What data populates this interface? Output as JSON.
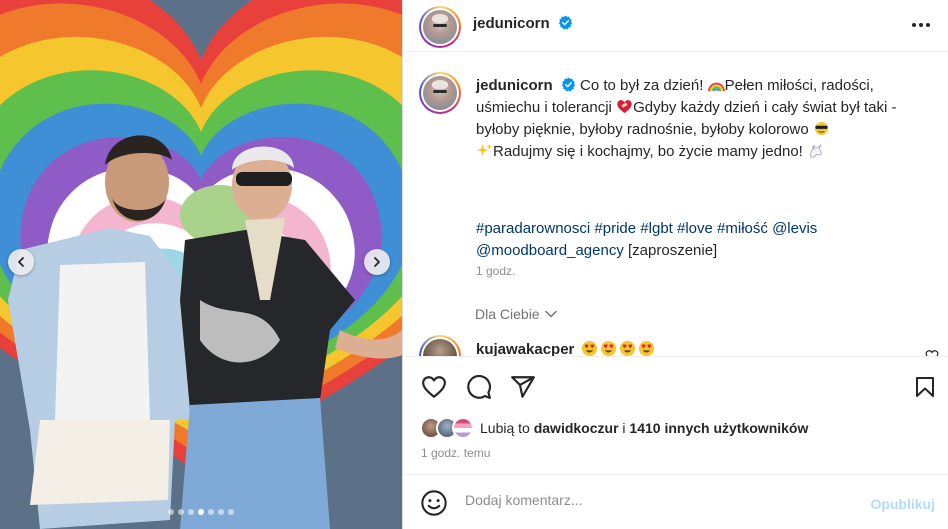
{
  "colors": {
    "link": "#00376b",
    "muted": "#8e8e8e",
    "verified": "#0095f6",
    "publish_disabled": "#b3dbff"
  },
  "photo": {
    "carousel_total": 7,
    "carousel_active": 3
  },
  "header": {
    "username": "jedunicorn",
    "verified_icon": "verified-badge-icon",
    "more_icon": "more-horizontal-icon"
  },
  "caption": {
    "username": "jedunicorn",
    "text_1": "Co to był za dzień!",
    "emoji_1": "rainbow",
    "text_2": "Pełen miłości, radości, uśmiechu i tolerancji",
    "emoji_2": "heart-with-bandage",
    "text_3": "Gdyby każdy dzień i cały świat był taki - byłoby pięknie, byłoby radnośnie, byłoby kolorowo",
    "emoji_3": "sunglasses-face",
    "emoji_4": "sparkles",
    "text_4": "Radujmy się i kochajmy, bo życie mamy jedno!",
    "emoji_5": "unicorn",
    "tags": [
      "#paradarownosci",
      "#pride",
      "#lgbt",
      "#love",
      "#miłość",
      "@levis",
      "@moodboard_agency"
    ],
    "tag_suffix": "[zaproszenie]",
    "time": "1 godz."
  },
  "for_you": "Dla Ciebie",
  "comment": {
    "username": "kujawakacper",
    "emojis": [
      "heart-eyes",
      "heart-eyes",
      "heart-eyes",
      "heart-eyes"
    ]
  },
  "actions": {
    "like_icon": "heart-icon",
    "comment_icon": "comment-icon",
    "share_icon": "send-icon",
    "save_icon": "bookmark-icon"
  },
  "likes": {
    "prefix": "Lubią to",
    "user": "dawidkoczur",
    "connector": "i",
    "others": "1410 innych użytkowników"
  },
  "post_time": "1 godz. temu",
  "composer": {
    "placeholder": "Dodaj komentarz...",
    "publish_label": "Opublikuj"
  }
}
